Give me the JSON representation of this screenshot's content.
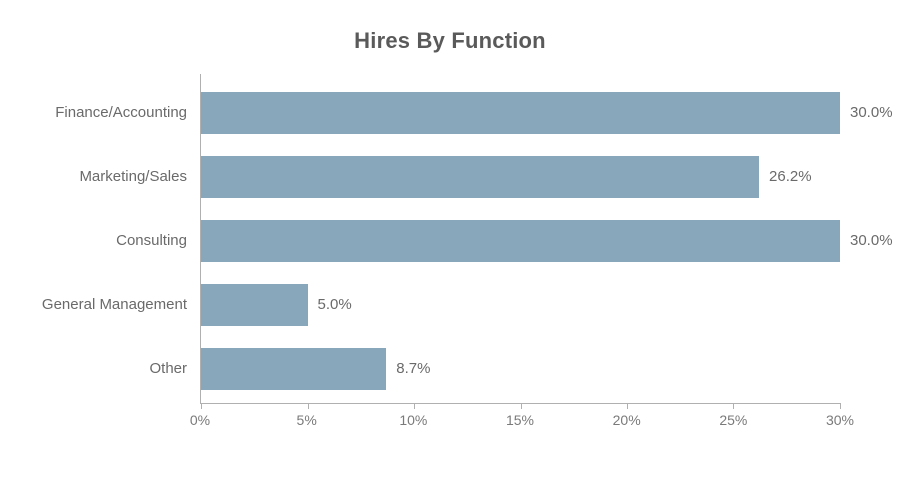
{
  "chart_data": {
    "type": "bar",
    "orientation": "horizontal",
    "title": "Hires By Function",
    "xlabel": "",
    "ylabel": "",
    "xlim": [
      0,
      30
    ],
    "x_ticks": [
      0,
      5,
      10,
      15,
      20,
      25,
      30
    ],
    "x_tick_labels": [
      "0%",
      "5%",
      "10%",
      "15%",
      "20%",
      "25%",
      "30%"
    ],
    "categories": [
      "Finance/Accounting",
      "Marketing/Sales",
      "Consulting",
      "General Management",
      "Other"
    ],
    "values": [
      30.0,
      26.2,
      30.0,
      5.0,
      8.7
    ],
    "value_labels": [
      "30.0%",
      "26.2%",
      "30.0%",
      "5.0%",
      "8.7%"
    ],
    "bar_color": "#89a7bb"
  }
}
